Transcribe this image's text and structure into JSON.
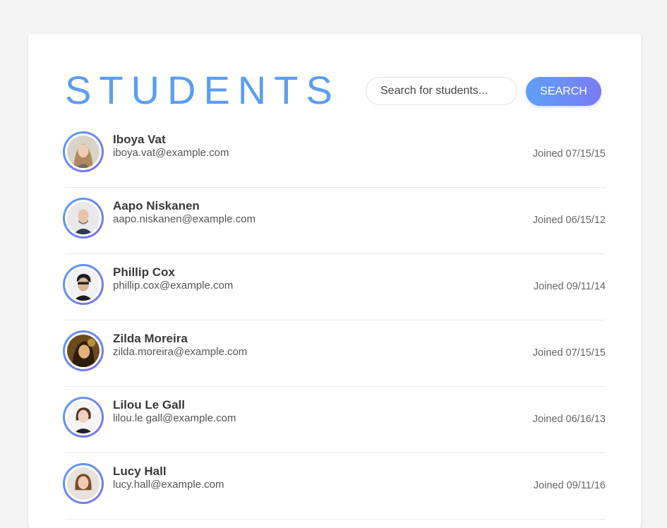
{
  "header": {
    "title": "STUDENTS"
  },
  "search": {
    "placeholder": "Search for students...",
    "button_label": "SEARCH"
  },
  "colors": {
    "title": "#5b9ef1",
    "button_gradient_start": "#5f9ff6",
    "button_gradient_end": "#7a7cf2"
  },
  "students": [
    {
      "name": "Iboya Vat",
      "email": "iboya.vat@example.com",
      "joined": "Joined 07/15/15",
      "avatar": "woman-portrait-icon"
    },
    {
      "name": "Aapo Niskanen",
      "email": "aapo.niskanen@example.com",
      "joined": "Joined 06/15/12",
      "avatar": "man-portrait-icon"
    },
    {
      "name": "Phillip Cox",
      "email": "phillip.cox@example.com",
      "joined": "Joined 09/11/14",
      "avatar": "man-portrait-icon"
    },
    {
      "name": "Zilda Moreira",
      "email": "zilda.moreira@example.com",
      "joined": "Joined 07/15/15",
      "avatar": "woman-portrait-icon"
    },
    {
      "name": "Lilou Le Gall",
      "email": "lilou.le gall@example.com",
      "joined": "Joined 06/16/13",
      "avatar": "woman-portrait-icon"
    },
    {
      "name": "Lucy Hall",
      "email": "lucy.hall@example.com",
      "joined": "Joined 09/11/16",
      "avatar": "woman-portrait-icon"
    }
  ]
}
